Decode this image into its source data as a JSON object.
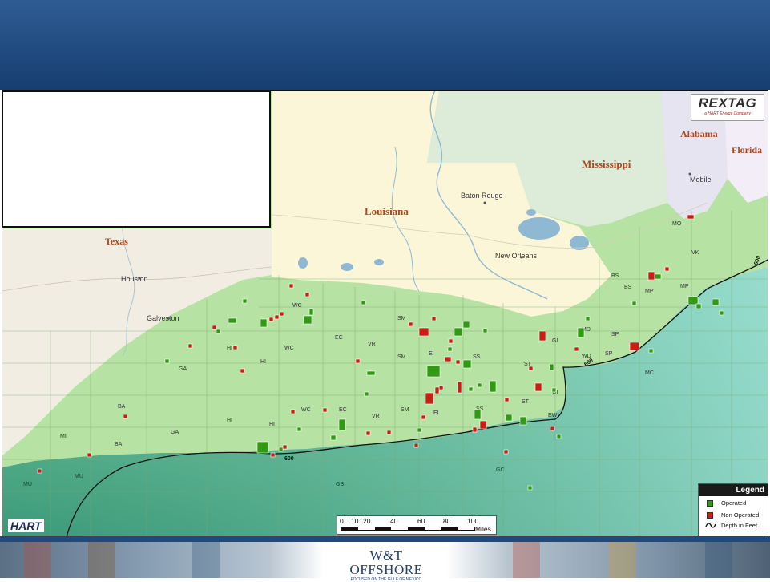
{
  "map": {
    "states": {
      "texas": "Texas",
      "louisiana": "Louisiana",
      "mississippi": "Mississippi",
      "alabama": "Alabama",
      "florida": "Florida"
    },
    "cities": {
      "houston": "Houston",
      "galveston": "Galveston",
      "baton_rouge": "Baton Rouge",
      "new_orleans": "New Orleans",
      "mobile": "Mobile"
    },
    "areas": [
      "MU",
      "MU",
      "MI",
      "BA",
      "BA",
      "GA",
      "GA",
      "HI",
      "HI",
      "HI",
      "HI",
      "WC",
      "WC",
      "WC",
      "EC",
      "EC",
      "VR",
      "VR",
      "SM",
      "SM",
      "SM",
      "EI",
      "EI",
      "SS",
      "SS",
      "ST",
      "ST",
      "GI",
      "GI",
      "MD",
      "WD",
      "SP",
      "SP",
      "MP",
      "MP",
      "BS",
      "BS",
      "VK",
      "MO",
      "MC",
      "EW",
      "GC",
      "GB"
    ],
    "depth_label": "600",
    "scale": {
      "ticks": [
        "0",
        "10",
        "20",
        "40",
        "60",
        "80",
        "100"
      ],
      "unit": "Miles"
    }
  },
  "legend": {
    "title": "Legend",
    "operated": "Operated",
    "non_operated": "Non Operated",
    "depth": "Depth in Feet"
  },
  "logos": {
    "rextag": "REXTAG",
    "rextag_tagline": "a HART Energy Company",
    "hart": "HART",
    "wt_offshore": "W&T OFFSHORE",
    "wt_tagline": "FOCUSED ON THE GULF OF MEXICO"
  },
  "colors": {
    "header_blue": "#1f4a80",
    "operated": "#2f9a12",
    "non_operated": "#c81e14",
    "land": "#fbf7df",
    "shelf_green": "#b7e3a6"
  }
}
